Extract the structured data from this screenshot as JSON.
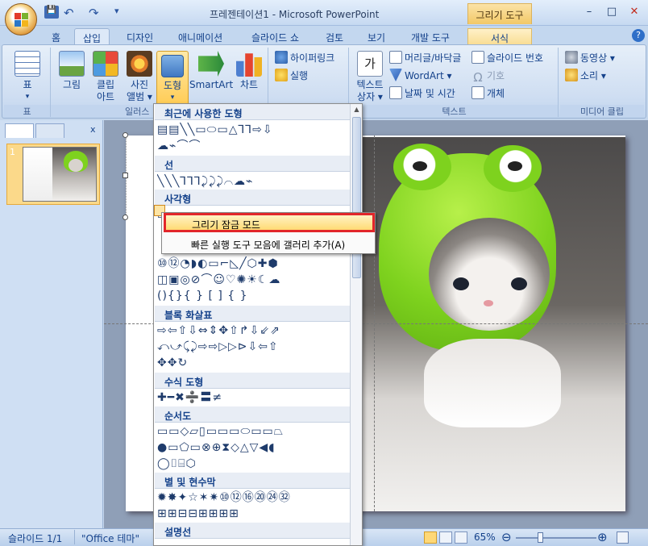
{
  "window": {
    "title": "프레젠테이션1 - Microsoft PowerPoint",
    "context_tab_title": "그리기 도구",
    "minimize": "–",
    "maximize": "□",
    "close": "✕"
  },
  "quick_access": {
    "save": "💾",
    "undo": "↶",
    "redo": "↷",
    "more": "▾"
  },
  "tabs": [
    "홈",
    "삽입",
    "디자인",
    "애니메이션",
    "슬라이드 쇼",
    "검토",
    "보기",
    "개발 도구",
    "서식"
  ],
  "active_tab": "삽입",
  "help": "?",
  "ribbon": {
    "table_group": {
      "button": "표",
      "arrow": "▾",
      "label": "표"
    },
    "illus_group": {
      "label": "일러스",
      "picture": "그림",
      "clipart_l1": "클립",
      "clipart_l2": "아트",
      "album_l1": "사진",
      "album_l2": "앨범 ▾",
      "shapes": "도형",
      "shapes_arrow": "▾",
      "smartart": "SmartArt",
      "chart": "차트"
    },
    "links_group": {
      "hyperlink": "하이퍼링크",
      "action": "실행"
    },
    "text_group": {
      "label": "텍스트",
      "textbox_l1": "텍스트",
      "textbox_l2": "상자 ▾",
      "header_footer": "머리글/바닥글",
      "wordart": "WordArt ▾",
      "datetime": "날짜 및 시간",
      "slide_number": "슬라이드 번호",
      "symbol": "기호",
      "object": "개체",
      "textbox_glyph": "가"
    },
    "media_group": {
      "label": "미디어 클립",
      "video": "동영상 ▾",
      "sound": "소리 ▾"
    }
  },
  "left_pane": {
    "close": "x",
    "slide_number": "1"
  },
  "gallery": {
    "categories": {
      "recent": "최근에 사용한 도형",
      "lines": "선",
      "rect": "사각형",
      "block_arrows": "블록 화살표",
      "equation": "수식 도형",
      "flowchart": "순서도",
      "stars": "별 및 현수막",
      "callouts": "설명선"
    },
    "icons": {
      "recent_1": "▤▤╲╲▭⬭▭△⅂⅂⇨⇩",
      "recent_2": "☁⌁⌒⌒",
      "lines_1": "╲╲╲⅂⅂⅂⤸⤸⤸⌒☁⌁",
      "rect_1": "▭▭▭▭▭▭▭▭▭",
      "basic_1": "⑩⑫◔◗◐▭⌐◺╱⬡✚⬢",
      "basic_2": "◫▣◎⊘⌒☺♡✺☀☾☁",
      "basic_3": "(){}{ } [ ] { }",
      "block_1": "⇨⇦⇧⇩⇔⇕✥⇧↱⇩⇙⇗",
      "block_2": "⤺⤻⤹⤸⇨⇨▷▷⊳⇩⇦⇧",
      "block_3": "✥✥↻",
      "eq_1": "✚━✖➗〓≠",
      "flow_1": "▭▭◇▱▯▭▭▭⬭▭▭⏢",
      "flow_2": "●▭⬠▭⊗⊕⧗◇△▽◀◖",
      "flow_3": "◯⌷⌸⬡",
      "stars_1": "✹✸✦☆✶✷⑩⑫⑯⑳㉔㉜",
      "stars_2": "⊞⊞⊟⊟⊞⊞⊞⊞",
      "callout_1": "▭▭▭▭▭▭▭▭"
    }
  },
  "context_menu": {
    "item1": "그리기 잠금 모드",
    "item2": "빠른 실행 도구 모음에 갤러리 추가(A)"
  },
  "status": {
    "slide": "슬라이드 1/1",
    "theme": "\"Office 테마\"",
    "zoom": "65%",
    "zoom_out": "⊖",
    "zoom_in": "⊕",
    "zoom_level_percent": 65
  }
}
